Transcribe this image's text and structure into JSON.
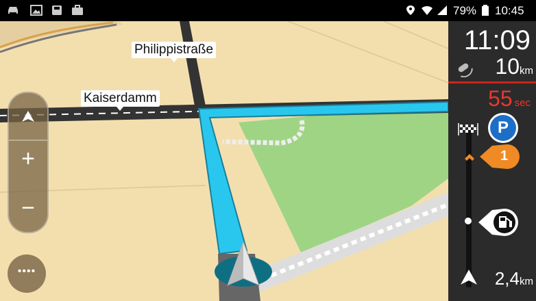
{
  "status_bar": {
    "battery_percent": "79%",
    "clock": "10:45",
    "icons": [
      "car-icon",
      "image-icon",
      "save-icon",
      "briefcase-icon",
      "location-icon",
      "wifi-icon",
      "signal-icon",
      "battery-icon"
    ]
  },
  "map": {
    "street_labels": [
      "Philippistraße",
      "Kaiserdamm"
    ],
    "colors": {
      "route": "#29c7ee",
      "land": "#f3dfae",
      "park": "#9fd485",
      "road": "#222222",
      "water_path": "#e7e7e7"
    }
  },
  "controls": {
    "zoom_in_label": "+",
    "zoom_out_label": "−",
    "menu_label": "••••"
  },
  "route_panel": {
    "eta": "11:09",
    "distance_value": "10",
    "distance_unit": "km",
    "delay_value": "55",
    "delay_unit": "sec",
    "parking_label": "P",
    "waypoint_number": "1",
    "remaining_value": "2,4",
    "remaining_unit": "km",
    "colors": {
      "accent": "#f08a24",
      "parking": "#1c6fc9",
      "delay": "#e8382d"
    }
  }
}
